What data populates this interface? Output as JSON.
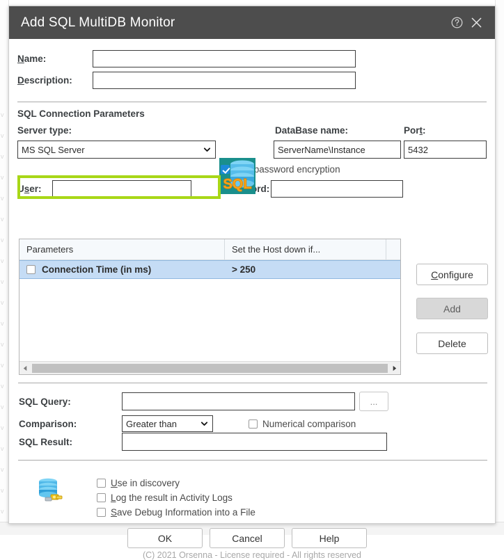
{
  "window": {
    "title": "Add SQL MultiDB Monitor",
    "help_icon": "help-circle-icon",
    "close_icon": "close-icon"
  },
  "general": {
    "name_label": "Name:",
    "name_accel": "N",
    "name_value": "",
    "description_label": "Description:",
    "description_accel": "D",
    "description_value": ""
  },
  "connection": {
    "section_title": "SQL Connection Parameters",
    "server_type_label": "Server type:",
    "server_type_value": "MS SQL Server",
    "server_type_highlight_color": "#a8d717",
    "database_label": "DataBase name:",
    "database_value": "ServerName\\Instance",
    "port_label": "Port:",
    "port_accel": "t",
    "port_value": "5432",
    "encryption_label": "Use password encryption",
    "encryption_checked": true,
    "user_label": "User:",
    "user_accel": "s",
    "user_value": "",
    "password_label": "Password:",
    "password_accel": "P",
    "password_value": "",
    "icon": "sql-database-icon"
  },
  "parameters_list": {
    "columns": [
      "Parameters",
      "Set the Host down if...",
      ""
    ],
    "rows": [
      {
        "checked": false,
        "parameter": "Connection Time (in ms)",
        "condition": "> 250",
        "selected": true
      }
    ],
    "scroll_left_icon": "caret-left-icon",
    "scroll_right_icon": "caret-right-icon"
  },
  "side_buttons": [
    {
      "label": "Configure",
      "accel": "C",
      "disabled": false,
      "name": "configure-button"
    },
    {
      "label": "Add",
      "accel": "",
      "disabled": true,
      "name": "add-button"
    },
    {
      "label": "Delete",
      "accel": "",
      "disabled": false,
      "name": "delete-button"
    }
  ],
  "query": {
    "sql_query_label": "SQL Query:",
    "sql_query_value": "",
    "browse_label": "...",
    "comparison_label": "Comparison:",
    "comparison_value": "Greater than",
    "numerical_label": "Numerical comparison",
    "numerical_checked": false,
    "sql_result_label": "SQL Result:",
    "sql_result_value": ""
  },
  "options": {
    "icon": "database-pipe-icon",
    "items": [
      {
        "label": "Use in discovery",
        "accel": "U",
        "checked": false
      },
      {
        "label": "Log the result in Activity Logs",
        "accel": "L",
        "checked": false
      },
      {
        "label": "Save Debug Information into a File",
        "accel": "S",
        "checked": false
      }
    ]
  },
  "actions": {
    "ok": "OK",
    "cancel": "Cancel",
    "help": "Help",
    "copyright": "(C) 2021 Orsenna - License required - All rights reserved"
  }
}
